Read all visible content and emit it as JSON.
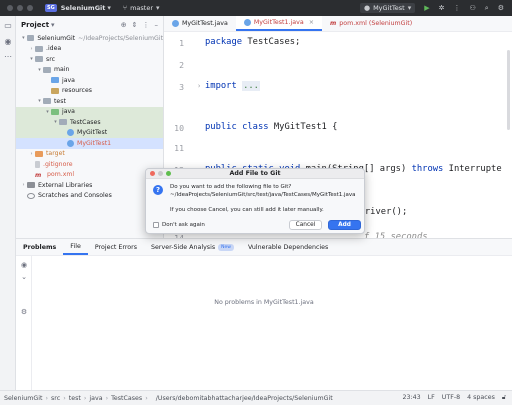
{
  "titlebar": {
    "project_badge": "SG",
    "project_name": "SeleniumGit",
    "branch": "master",
    "run_config": "MyGitTest"
  },
  "project_panel": {
    "title": "Project",
    "tree": [
      {
        "label": "SeleniumGit",
        "hint": "~/IdeaProjects/SeleniumGit",
        "indent": 0,
        "arrow": "▾",
        "icon": "folder",
        "style": ""
      },
      {
        "label": ".idea",
        "indent": 1,
        "arrow": "▸",
        "icon": "folder",
        "style": ""
      },
      {
        "label": "src",
        "indent": 1,
        "arrow": "▾",
        "icon": "folder",
        "style": ""
      },
      {
        "label": "main",
        "indent": 2,
        "arrow": "▾",
        "icon": "folder",
        "style": ""
      },
      {
        "label": "java",
        "indent": 3,
        "arrow": "",
        "icon": "folder-src",
        "style": ""
      },
      {
        "label": "resources",
        "indent": 3,
        "arrow": "",
        "icon": "folder-res",
        "style": ""
      },
      {
        "label": "test",
        "indent": 2,
        "arrow": "▾",
        "icon": "folder",
        "style": ""
      },
      {
        "label": "java",
        "indent": 3,
        "arrow": "▾",
        "icon": "folder-test",
        "style": "hl"
      },
      {
        "label": "TestCases",
        "indent": 4,
        "arrow": "▾",
        "icon": "folder",
        "style": "hl"
      },
      {
        "label": "MyGitTest",
        "indent": 5,
        "arrow": "",
        "icon": "class",
        "style": "hl"
      },
      {
        "label": "MyGitTest1",
        "indent": 5,
        "arrow": "",
        "icon": "class",
        "style": "sel red"
      },
      {
        "label": "target",
        "indent": 1,
        "arrow": "▸",
        "icon": "folder-orange",
        "style": "orange"
      },
      {
        "label": ".gitignore",
        "indent": 1,
        "arrow": "",
        "icon": "file",
        "style": "red"
      },
      {
        "label": "pom.xml",
        "indent": 1,
        "arrow": "",
        "icon": "maven",
        "style": "red"
      },
      {
        "label": "External Libraries",
        "indent": 0,
        "arrow": "▸",
        "icon": "lib",
        "style": ""
      },
      {
        "label": "Scratches and Consoles",
        "indent": 0,
        "arrow": "",
        "icon": "scratch",
        "style": ""
      }
    ]
  },
  "editor": {
    "tabs": [
      {
        "label": "MyGitTest.java",
        "active": false
      },
      {
        "label": "MyGitTest1.java",
        "active": true
      },
      {
        "label": "pom.xml (SeleniumGit)",
        "active": false
      }
    ],
    "lines": [
      {
        "num": "1",
        "text": "package TestCases;"
      },
      {
        "num": "2",
        "text": ""
      },
      {
        "num": "3",
        "text": "import ..."
      },
      {
        "num": "10",
        "text": "public class MyGitTest1 {"
      },
      {
        "num": "11",
        "text": ""
      },
      {
        "num": "12",
        "text": "    public static void main(String[] args) throws Interrupte"
      },
      {
        "num": "13",
        "text": "geDriver();"
      },
      {
        "num": "14",
        "text": "f 15 seconds"
      }
    ]
  },
  "problems": {
    "tabs": [
      "Problems",
      "File",
      "Project Errors",
      "Server-Side Analysis",
      "Vulnerable Dependencies"
    ],
    "new_badge": "New",
    "empty_text": "No problems in MyGitTest1.java"
  },
  "statusbar": {
    "crumbs": [
      "SeleniumGit",
      "src",
      "test",
      "java",
      "TestCases"
    ],
    "path": "/Users/debomitabhattacharjee/IdeaProjects/SeleniumGit",
    "time": "23:43",
    "line_ending": "LF",
    "encoding": "UTF-8",
    "indent": "4 spaces"
  },
  "dialog": {
    "title": "Add File to Git",
    "question": "Do you want to add the following file to Git?",
    "file_path": "~/IdeaProjects/SeleniumGit/src/test/java/TestCases/MyGitTest1.java",
    "note": "If you choose Cancel, you can still add it later manually.",
    "checkbox_label": "Don't ask again",
    "cancel_label": "Cancel",
    "add_label": "Add"
  },
  "colors": {
    "accent": "#3574f0",
    "untracked_red": "#c23e3e",
    "keyword_blue": "#0033b3"
  }
}
